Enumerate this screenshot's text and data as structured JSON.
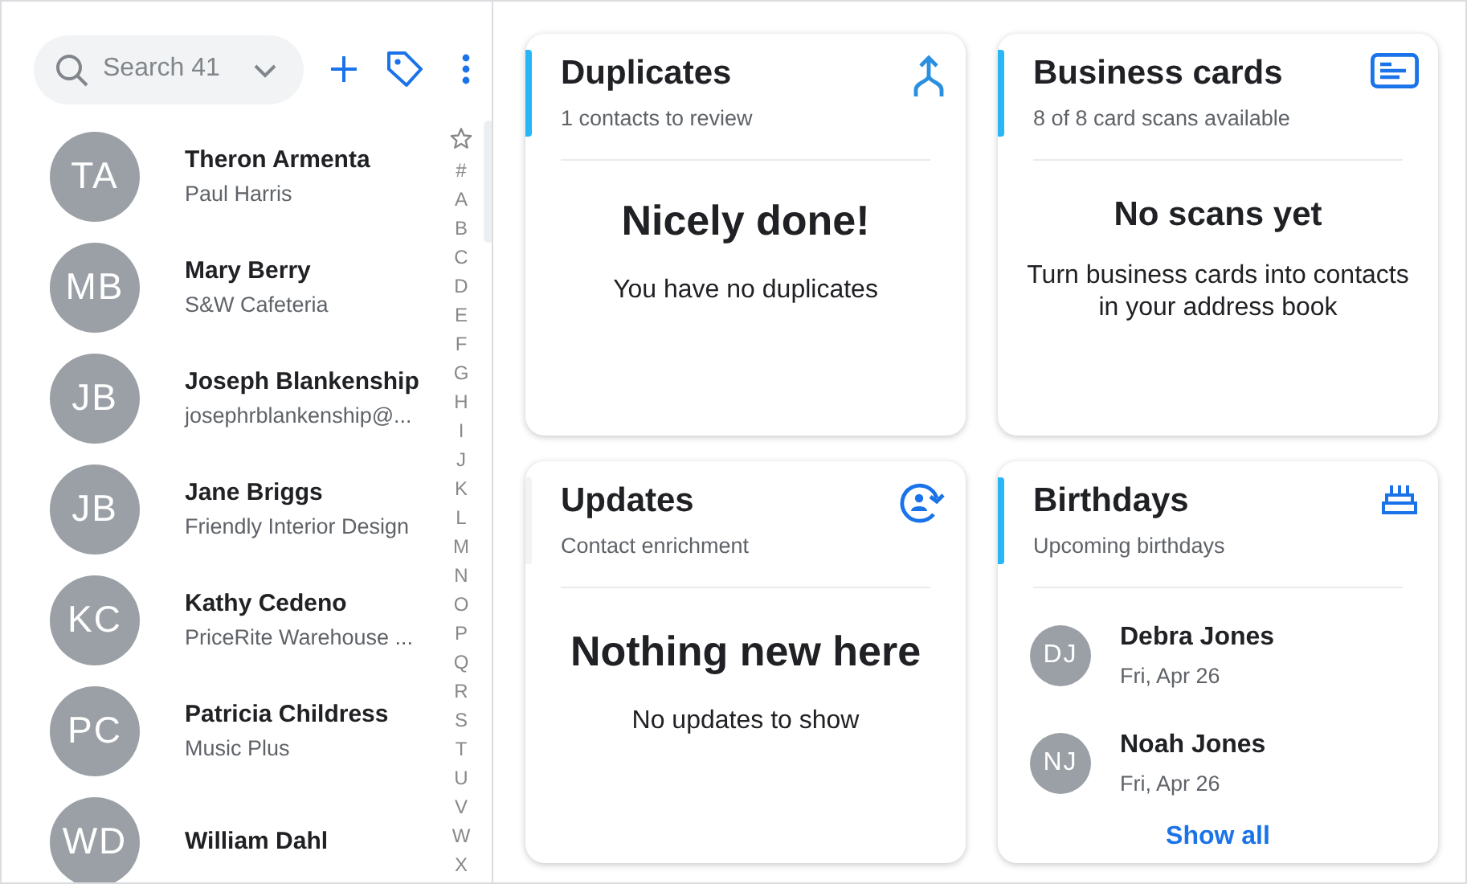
{
  "sidebar": {
    "search": {
      "placeholder": "Search 41"
    },
    "contacts": [
      {
        "initials": "TA",
        "name": "Theron Armenta",
        "detail": "Paul Harris"
      },
      {
        "initials": "MB",
        "name": "Mary Berry",
        "detail": "S&W Cafeteria"
      },
      {
        "initials": "JB",
        "name": "Joseph Blankenship",
        "detail": "josephrblankenship@..."
      },
      {
        "initials": "JB",
        "name": "Jane Briggs",
        "detail": "Friendly Interior Design"
      },
      {
        "initials": "KC",
        "name": "Kathy Cedeno",
        "detail": "PriceRite Warehouse ..."
      },
      {
        "initials": "PC",
        "name": "Patricia Childress",
        "detail": "Music Plus"
      },
      {
        "initials": "WD",
        "name": "William Dahl"
      }
    ],
    "index": [
      "#",
      "A",
      "B",
      "C",
      "D",
      "E",
      "F",
      "G",
      "H",
      "I",
      "J",
      "K",
      "L",
      "M",
      "N",
      "O",
      "P",
      "Q",
      "R",
      "S",
      "T",
      "U",
      "V",
      "W",
      "X"
    ]
  },
  "cards": [
    {
      "kind": "message",
      "title": "Duplicates",
      "subtitle": "1 contacts to review",
      "accent": true,
      "headline": "Nicely done!",
      "message": "You have no duplicates"
    },
    {
      "kind": "message",
      "title": "Business cards",
      "subtitle": "8 of 8 card scans available",
      "accent": true,
      "headline": "No scans yet",
      "message": "Turn business cards into contacts in your address book"
    },
    {
      "kind": "message",
      "title": "Updates",
      "subtitle": "Contact enrichment",
      "accent": false,
      "headline": "Nothing new here",
      "message": "No updates to show"
    },
    {
      "kind": "list",
      "title": "Birthdays",
      "subtitle": "Upcoming birthdays",
      "accent": true,
      "people": [
        {
          "initials": "DJ",
          "name": "Debra Jones",
          "date": "Fri, Apr 26"
        },
        {
          "initials": "NJ",
          "name": "Noah Jones",
          "date": "Fri, Apr 26"
        }
      ],
      "link": "Show all"
    }
  ]
}
